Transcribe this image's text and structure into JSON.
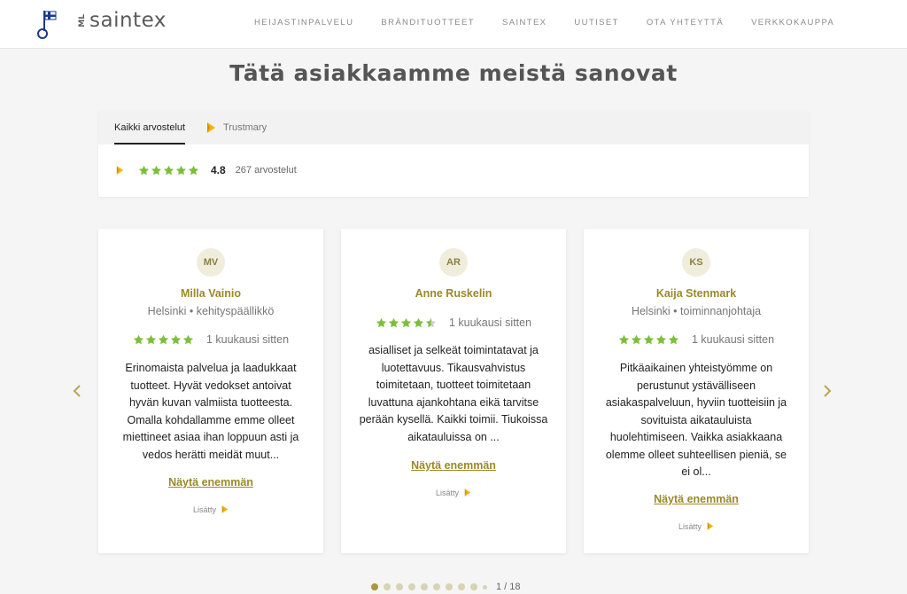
{
  "header": {
    "brand": "saintex",
    "brand_prefix": "ML",
    "nav": [
      "HEIJASTINPALVELU",
      "BRÄNDITUOTTEET",
      "SAINTEX",
      "UUTISET",
      "OTA YHTEYTTÄ",
      "VERKKOKAUPPA"
    ]
  },
  "page_title": "Tätä asiakkaamme meistä sanovat",
  "summary": {
    "tabs": [
      "Kaikki arvostelut",
      "Trustmary"
    ],
    "score": "4.8",
    "count": "267 arvostelut",
    "stars": 5
  },
  "reviews": [
    {
      "initials": "MV",
      "name": "Milla Vainio",
      "meta": "Helsinki • kehityspäällikkö",
      "rating": 5,
      "time": "1 kuukausi sitten",
      "text": "Erinomaista palvelua ja laadukkaat tuotteet. Hyvät vedokset antoivat hyvän kuvan valmiista tuotteesta. Omalla kohdallamme emme olleet miettineet asiaa ihan loppuun asti ja vedos herätti meidät muut...",
      "more": "Näytä enemmän",
      "added": "Lisätty"
    },
    {
      "initials": "AR",
      "name": "Anne Ruskelin",
      "meta": "",
      "rating": 4.5,
      "time": "1 kuukausi sitten",
      "text": "asialliset ja selkeät toimintatavat ja luotettavuus. Tikausvahvistus toimitetaan, tuotteet toimitetaan luvattuna ajankohtana eikä tarvitse perään kysellä. Kaikki toimii. Tiukoissa aikatauluissa on ...",
      "more": "Näytä enemmän",
      "added": "Lisätty"
    },
    {
      "initials": "KS",
      "name": "Kaija Stenmark",
      "meta": "Helsinki • toiminnanjohtaja",
      "rating": 5,
      "time": "1 kuukausi sitten",
      "text": "Pitkäaikainen yhteistyömme on perustunut ystävälliseen asiakaspalveluun, hyviin tuotteisiin ja sovituista aikatauluista huolehtimiseen. Vaikka asiakkaana olemme olleet suhteellisen pieniä, se ei ol...",
      "more": "Näytä enemmän",
      "added": "Lisätty"
    }
  ],
  "pager": {
    "label": "1 / 18",
    "current": 1
  },
  "colors": {
    "accent": "#9a8a2a",
    "star": "#7cbf3a",
    "trustmary": "#f5b400"
  },
  "icons": {
    "prev": "chevron-left-icon",
    "next": "chevron-right-icon",
    "trustmary": "trustmary-logo-icon"
  }
}
